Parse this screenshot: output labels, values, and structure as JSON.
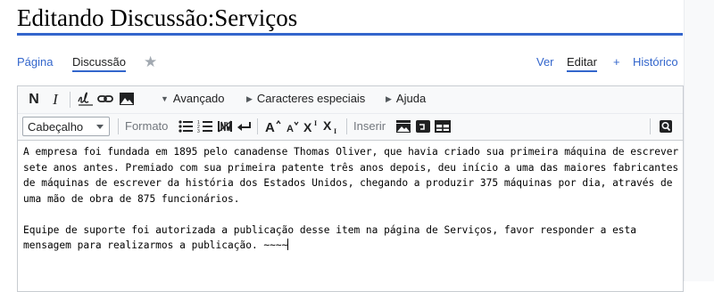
{
  "page": {
    "title": "Editando Discussão:Serviços"
  },
  "tabs": {
    "left": [
      {
        "label": "Página"
      },
      {
        "label": "Discussão"
      }
    ],
    "right": [
      {
        "label": "Ver"
      },
      {
        "label": "Editar"
      },
      {
        "label": "+"
      },
      {
        "label": "Histórico"
      }
    ],
    "selected_left": "Discussão",
    "selected_right": "Editar"
  },
  "toolbar": {
    "bold_label": "N",
    "italic_label": "I",
    "menus": {
      "advanced": "Avançado",
      "special_chars": "Caracteres especiais",
      "help": "Ajuda"
    },
    "heading_select": {
      "value": "Cabeçalho"
    },
    "format_label": "Formato",
    "insert_label": "Inserir",
    "icons": [
      "signature-icon",
      "link-icon",
      "image-icon",
      "bulleted-list-icon",
      "numbered-list-icon",
      "nowiki-icon",
      "newline-icon",
      "big-text-icon",
      "small-text-icon",
      "superscript-icon",
      "subscript-icon",
      "gallery-icon",
      "media-icon",
      "table-icon",
      "search-replace-icon"
    ]
  },
  "editor": {
    "paragraph_1": [
      "A empresa foi fundada em 1895 pelo canadense Thomas Oliver, que havia criado sua primeira máquina de escrever",
      "sete anos antes. Premiado com sua primeira patente três anos depois, deu início a uma das maiores fabricantes",
      "de máquinas de escrever da história dos Estados Unidos, chegando a produzir 375 máquinas por dia, através de",
      "uma mão de obra de 875 funcionários."
    ],
    "paragraph_2": [
      "Equipe de suporte foi autorizada a publicação desse item na página de Serviços, favor responder a esta",
      "mensagem para realizarmos a publicação. ~~~~"
    ]
  },
  "colors": {
    "accent": "#3366cc",
    "toolbar_bg": "#f8f9fa",
    "border": "#c8ccd1"
  }
}
